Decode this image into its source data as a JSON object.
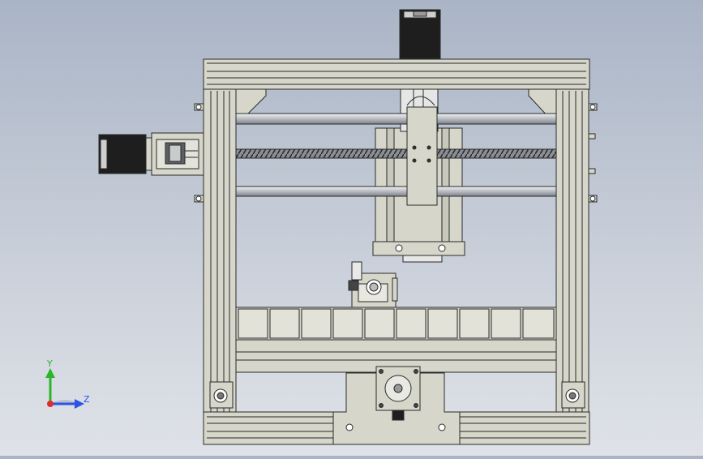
{
  "viewport": {
    "background_top": "#a9b4c6",
    "background_bottom": "#dfe2e8"
  },
  "model": {
    "part_fill": "#d6d6ca",
    "part_stroke": "#2a2a2a",
    "rod_fill": "#b9bdc2",
    "motor_dark": "#1e1e1e"
  },
  "triad": {
    "y_label": "Y",
    "z_label": "Z",
    "y_color": "#2bb52b",
    "z_color": "#2d53e6",
    "x_color": "#e02b2b"
  }
}
